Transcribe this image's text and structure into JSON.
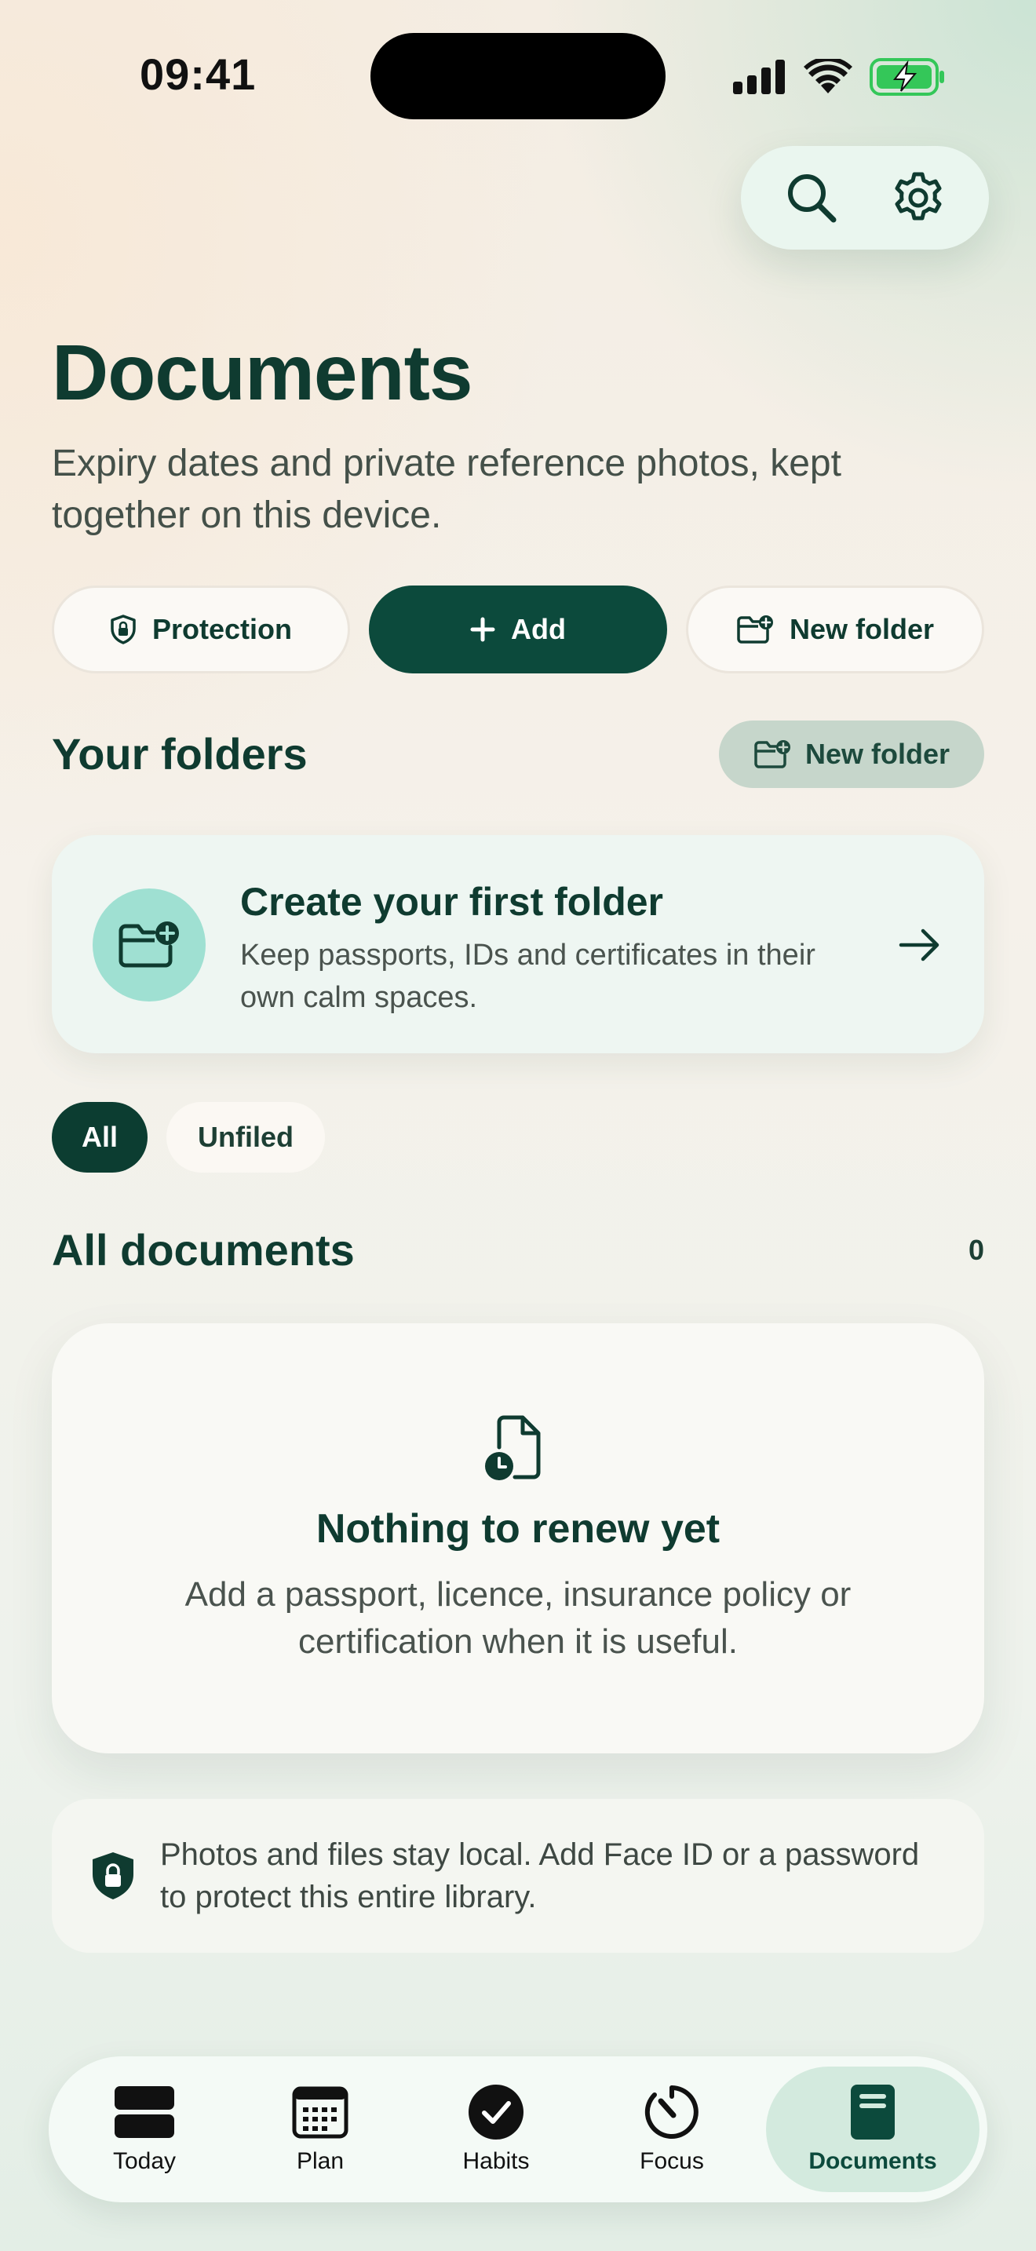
{
  "status_bar": {
    "time": "09:41"
  },
  "top_actions": {
    "search_icon": "search-icon",
    "settings_icon": "gear-icon"
  },
  "header": {
    "title": "Documents",
    "subtitle": "Expiry dates and private reference photos, kept together on this device."
  },
  "actions": {
    "protection_label": "Protection",
    "add_label": "Add",
    "new_folder_label": "New folder"
  },
  "folders": {
    "title": "Your folders",
    "new_folder_label": "New folder",
    "empty_card": {
      "title": "Create your first folder",
      "description": "Keep passports, IDs and certificates in their own calm spaces."
    }
  },
  "filters": {
    "items": [
      {
        "label": "All",
        "active": true
      },
      {
        "label": "Unfiled",
        "active": false
      }
    ]
  },
  "documents": {
    "title": "All documents",
    "count": "0",
    "empty": {
      "title": "Nothing to renew yet",
      "description": "Add a passport, licence, insurance policy or certification when it is useful."
    }
  },
  "privacy_note": {
    "text": "Photos and files stay local. Add Face ID or a password to protect this entire library."
  },
  "tab_bar": {
    "items": [
      {
        "label": "Today",
        "icon": "today-icon",
        "active": false
      },
      {
        "label": "Plan",
        "icon": "calendar-icon",
        "active": false
      },
      {
        "label": "Habits",
        "icon": "checkmark-circle-icon",
        "active": false
      },
      {
        "label": "Focus",
        "icon": "timer-icon",
        "active": false
      },
      {
        "label": "Documents",
        "icon": "document-icon",
        "active": true
      }
    ]
  },
  "colors": {
    "accent": "#0c4a3c",
    "text": "#0f3b30",
    "mint": "#9fe0d2",
    "battery": "#34c759"
  }
}
